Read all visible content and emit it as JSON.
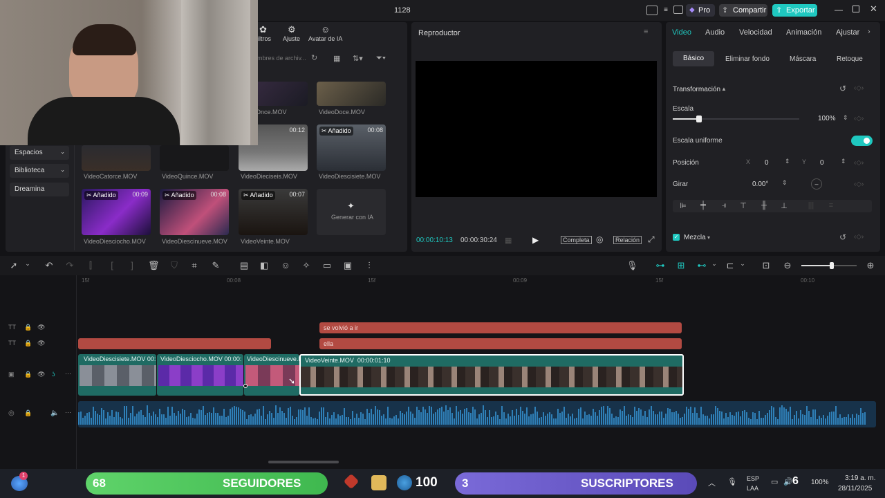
{
  "titlebar": {
    "project_name": "1128",
    "pro_label": "Pro",
    "share_label": "Compartir",
    "export_label": "Exportar"
  },
  "media_toolbar": {
    "items": [
      "iltros",
      "Ajuste",
      "Avatar de IA"
    ]
  },
  "search": {
    "placeholder": "mbres de archiv..."
  },
  "sidebar": {
    "items": [
      "Espacios",
      "Biblioteca",
      "Dreamina"
    ]
  },
  "media": {
    "added_label": "Añadido",
    "generate_label": "Generar con IA",
    "items": [
      {
        "name": "Once.MOV",
        "duration": ""
      },
      {
        "name": "VideoDoce.MOV",
        "duration": ""
      },
      {
        "name": "VideoCatorce.MOV",
        "duration": ""
      },
      {
        "name": "VideoQuince.MOV",
        "duration": ""
      },
      {
        "name": "VideoDieciseis.MOV",
        "duration": "00:12"
      },
      {
        "name": "VideoDiescisiete.MOV",
        "duration": "00:08"
      },
      {
        "name": "VideoDiesciocho.MOV",
        "duration": "00:09"
      },
      {
        "name": "VideoDiescinueve.MOV",
        "duration": "00:08"
      },
      {
        "name": "VideoVeinte.MOV",
        "duration": "00:07"
      }
    ]
  },
  "player": {
    "title": "Reproductor",
    "current_time": "00:00:10:13",
    "total_time": "00:00:30:24",
    "full_label": "Completa",
    "ratio_label": "Relación"
  },
  "inspector": {
    "tabs": [
      "Video",
      "Audio",
      "Velocidad",
      "Animación",
      "Ajustar"
    ],
    "subtabs": [
      "Básico",
      "Eliminar fondo",
      "Máscara",
      "Retoque"
    ],
    "section_title": "Transformación",
    "scale_label": "Escala",
    "scale_value": "100%",
    "scale_fraction": 0.21,
    "uniform_label": "Escala uniforme",
    "uniform_on": true,
    "position_label": "Posición",
    "x_label": "X",
    "x_value": "0",
    "y_label": "Y",
    "y_value": "0",
    "rotate_label": "Girar",
    "rotate_value": "0.00°",
    "blend_label": "Mezcla"
  },
  "ruler": {
    "marks": [
      "15f",
      "00:08",
      "15f",
      "00:09",
      "15f",
      "00:10"
    ]
  },
  "timeline": {
    "text_clips_row1": [
      "se volvió a ir"
    ],
    "text_clips_row2": [
      "",
      "ella"
    ],
    "video_clips": [
      {
        "name": "VideoDiescisiete.MOV",
        "extra": "00:"
      },
      {
        "name": "VideoDiesciocho.MOV",
        "extra": "00:00:"
      },
      {
        "name": "VideoDiescinueve.M",
        "extra": ""
      },
      {
        "name": "VideoVeinte.MOV",
        "extra": "00:00:01:10"
      }
    ]
  },
  "taskbar": {
    "followers_count": "68",
    "followers_label": "SEGUIDORES",
    "center_count": "100",
    "subs_count": "3",
    "subs_label": "SUSCRIPTORES",
    "lang": "ESP",
    "lang2": "LAA",
    "badge_number": "6",
    "battery": "100%",
    "time": "3:19 a. m.",
    "date": "28/11/2025",
    "notif_count": "1"
  },
  "colors": {
    "accent": "#1fc8c0",
    "text_clip": "#b24a42",
    "video_clip": "#1f6b63",
    "audio_wave": "#2f80b8"
  }
}
